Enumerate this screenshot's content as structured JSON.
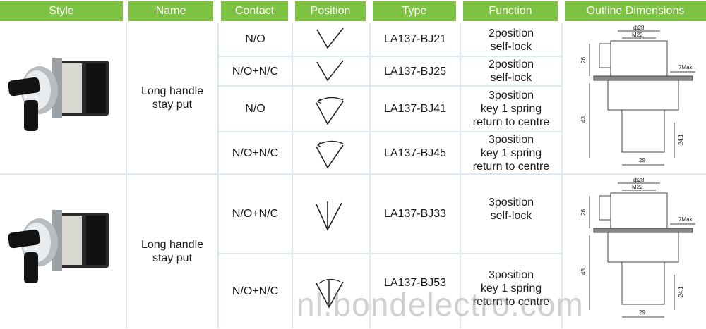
{
  "header": {
    "style": "Style",
    "name": "Name",
    "contact": "Contact",
    "position": "Position",
    "type": "Type",
    "function": "Function",
    "outline": "Outline Dimensions"
  },
  "colors": {
    "header_bg": "#7dc242",
    "header_text": "#ffffff",
    "grid": "#d9eaf2"
  },
  "groups": [
    {
      "name_line1": "Long handle",
      "name_line2": "stay put"
    },
    {
      "name_line1": "Long handle",
      "name_line2": "stay put"
    }
  ],
  "rows": [
    {
      "contact": "N/O",
      "position_icon": "v-2pos-icon",
      "type": "LA137-BJ21",
      "function_l1": "2position",
      "function_l2": "self-lock",
      "function_l3": ""
    },
    {
      "contact": "N/O+N/C",
      "position_icon": "v-2pos-icon",
      "type": "LA137-BJ25",
      "function_l1": "2position",
      "function_l2": "self-lock",
      "function_l3": ""
    },
    {
      "contact": "N/O",
      "position_icon": "v-arc-spring-icon",
      "type": "LA137-BJ41",
      "function_l1": "3position",
      "function_l2": "key 1 spring",
      "function_l3": "return to centre"
    },
    {
      "contact": "N/O+N/C",
      "position_icon": "v-arc-spring-icon",
      "type": "LA137-BJ45",
      "function_l1": "3position",
      "function_l2": "key 1 spring",
      "function_l3": "return to centre"
    },
    {
      "contact": "N/O+N/C",
      "position_icon": "v-3pos-icon",
      "type": "LA137-BJ33",
      "function_l1": "3position",
      "function_l2": "self-lock",
      "function_l3": ""
    },
    {
      "contact": "N/O+N/C",
      "position_icon": "v-3pos-arc-icon",
      "type": "LA137-BJ53",
      "function_l1": "3position",
      "function_l2": "key 1 spring",
      "function_l3": "return to centre"
    }
  ],
  "dimensions": {
    "diameter": "ф28",
    "thread": "M22",
    "height_top": "26",
    "max_panel": "7Max",
    "height_body": "43",
    "height_block": "24.1",
    "width": "29"
  },
  "watermark": "nl.bondelectro.com"
}
